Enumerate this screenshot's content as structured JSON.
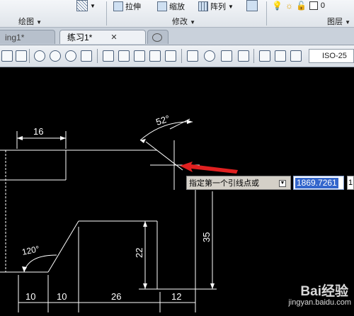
{
  "ribbon": {
    "panels": [
      "绘图",
      "修改",
      "图层"
    ],
    "buttons": [
      "拉伸",
      "缩放",
      "阵列"
    ],
    "layer_value": "0"
  },
  "tabs": [
    {
      "label": "ing1*"
    },
    {
      "label": "练习1*"
    }
  ],
  "toolbar": {
    "dim_style": "ISO-25"
  },
  "drawing": {
    "dimensions": [
      "16",
      "52°",
      "120°",
      "35",
      "22",
      "10",
      "10",
      "26",
      "12"
    ]
  },
  "command": {
    "prompt": "指定第一个引线点或",
    "input_value": "1869.7261",
    "input_value2": "1"
  },
  "watermark": {
    "brand": "Bai经验",
    "url": "jingyan.baidu.com"
  },
  "colors": {
    "background": "#000000",
    "lines": "#ffffff",
    "arrow": "#e02020",
    "selection": "#3366cc"
  }
}
